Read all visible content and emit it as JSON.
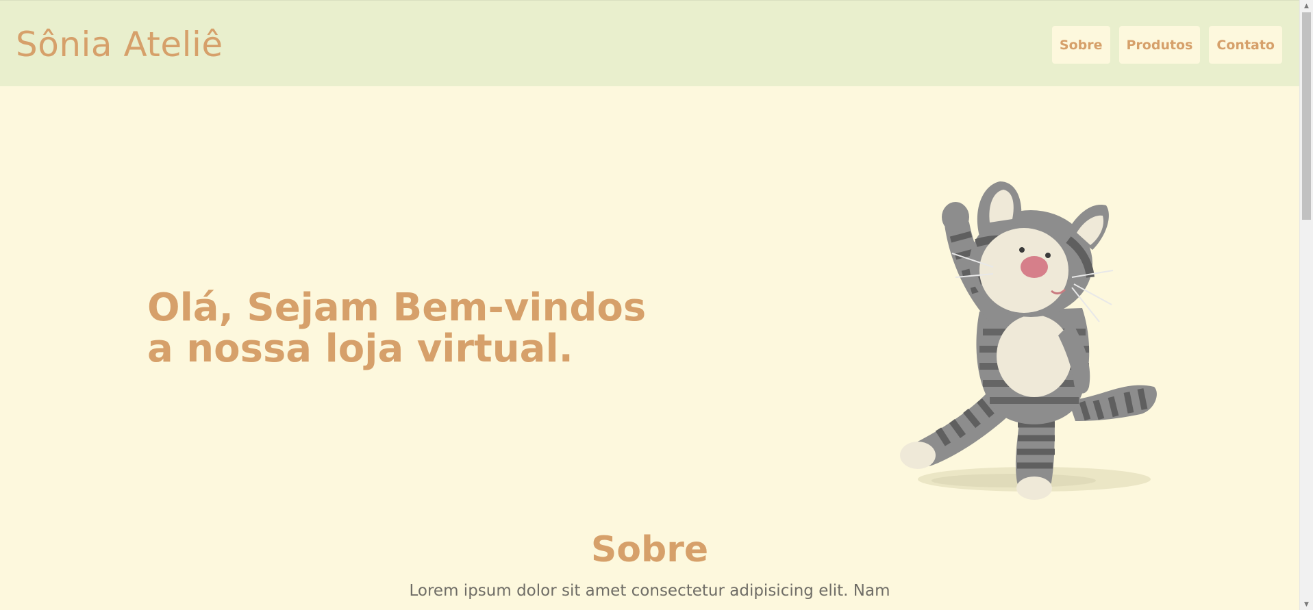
{
  "header": {
    "brand": "Sônia Ateliê",
    "nav": [
      {
        "label": "Sobre"
      },
      {
        "label": "Produtos"
      },
      {
        "label": "Contato"
      }
    ]
  },
  "hero": {
    "title_line1": "Olá, Sejam Bem-vindos",
    "title_line2": "a nossa loja virtual.",
    "image": "knitted-cat-toy"
  },
  "about": {
    "title": "Sobre",
    "text": "Lorem ipsum dolor sit amet consectetur adipisicing elit. Nam"
  },
  "colors": {
    "header_bg": "#e9efcd",
    "page_bg": "#fdf8dd",
    "accent": "#d6a06a",
    "body_text": "#6f6d66"
  }
}
